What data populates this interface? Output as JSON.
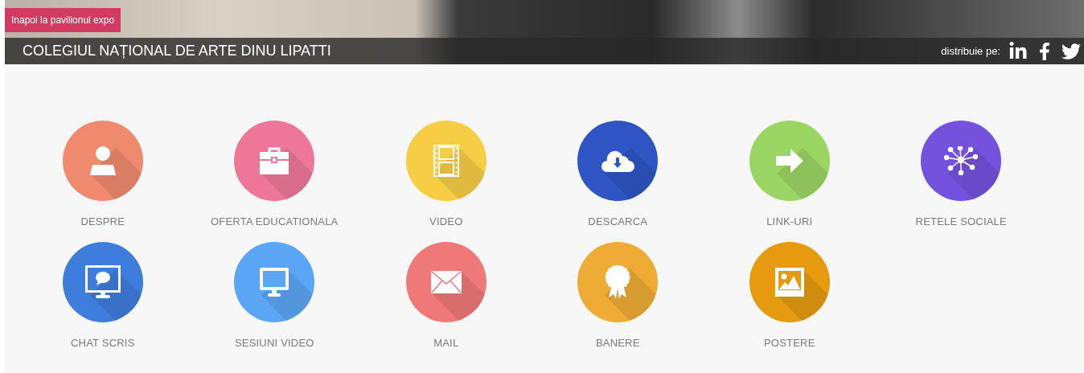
{
  "back_button": {
    "label": "Inapoi la pavilionul expo"
  },
  "header": {
    "title": "COLEGIUL NAȚIONAL DE ARTE DINU LIPATTI",
    "share_label": "distribuie pe:",
    "share_links": [
      {
        "kind": "linkedin"
      },
      {
        "kind": "facebook"
      },
      {
        "kind": "twitter"
      }
    ]
  },
  "tiles": [
    {
      "label": "DESPRE",
      "kind": "person",
      "color": "#ef8a6e"
    },
    {
      "label": "OFERTA EDUCATIONALA",
      "kind": "briefcase",
      "color": "#ee7799"
    },
    {
      "label": "VIDEO",
      "kind": "film",
      "color": "#f6cd45"
    },
    {
      "label": "DESCARCA",
      "kind": "cloud",
      "color": "#2f55c4"
    },
    {
      "label": "LINK-URI",
      "kind": "arrow",
      "color": "#9bd665"
    },
    {
      "label": "RETELE SOCIALE",
      "kind": "network",
      "color": "#7552dd"
    },
    {
      "label": "CHAT SCRIS",
      "kind": "chat",
      "color": "#3f7ddc"
    },
    {
      "label": "SESIUNI VIDEO",
      "kind": "monitor",
      "color": "#5ba6f4"
    },
    {
      "label": "MAIL",
      "kind": "mail",
      "color": "#ef7878"
    },
    {
      "label": "BANERE",
      "kind": "award",
      "color": "#eeab35"
    },
    {
      "label": "POSTERE",
      "kind": "picture",
      "color": "#e59a10"
    }
  ]
}
